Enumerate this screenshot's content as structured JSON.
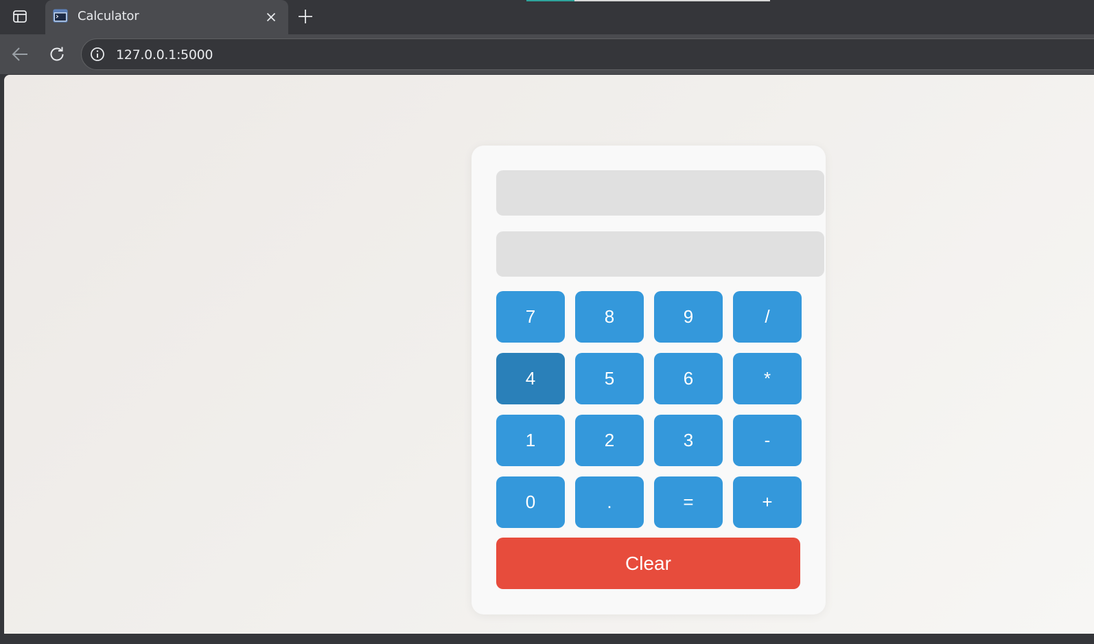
{
  "browser": {
    "tab": {
      "title": "Calculator",
      "favicon": "terminal-window-icon"
    },
    "omnibox": {
      "url": "127.0.0.1:5000"
    },
    "icons": {
      "sidebar": "tab-sidebar-icon",
      "close": "close-icon",
      "new_tab": "plus-icon",
      "back": "back-arrow-icon",
      "reload": "reload-icon",
      "site_info": "info-circle-icon"
    },
    "colors": {
      "tabstrip": "#35363a",
      "toolbar": "#4a4b4f",
      "loading_accent": "#2ea39b"
    }
  },
  "calculator": {
    "expression_display": {
      "value": "",
      "placeholder": ""
    },
    "result_display": {
      "value": "",
      "placeholder": ""
    },
    "keys": [
      {
        "label": "7",
        "id": "key-7"
      },
      {
        "label": "8",
        "id": "key-8"
      },
      {
        "label": "9",
        "id": "key-9"
      },
      {
        "label": "/",
        "id": "key-divide"
      },
      {
        "label": "4",
        "id": "key-4",
        "state": "hover"
      },
      {
        "label": "5",
        "id": "key-5"
      },
      {
        "label": "6",
        "id": "key-6"
      },
      {
        "label": "*",
        "id": "key-multiply"
      },
      {
        "label": "1",
        "id": "key-1"
      },
      {
        "label": "2",
        "id": "key-2"
      },
      {
        "label": "3",
        "id": "key-3"
      },
      {
        "label": "-",
        "id": "key-subtract"
      },
      {
        "label": "0",
        "id": "key-0"
      },
      {
        "label": ".",
        "id": "key-decimal"
      },
      {
        "label": "=",
        "id": "key-equals"
      },
      {
        "label": "+",
        "id": "key-add"
      }
    ],
    "clear_label": "Clear",
    "colors": {
      "key": "#3498db",
      "key_hover": "#2a80b9",
      "clear": "#e74c3c",
      "display": "#e0e0e0",
      "card": "#f9f9f9"
    }
  }
}
